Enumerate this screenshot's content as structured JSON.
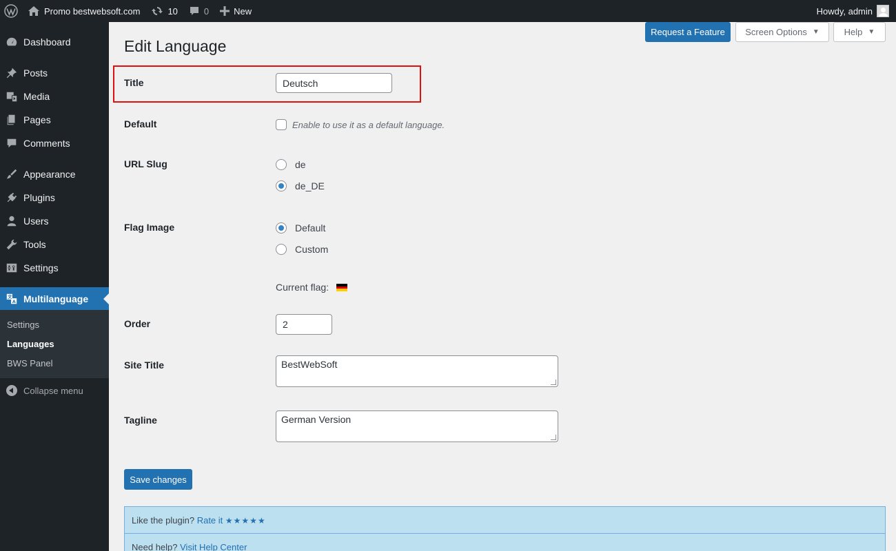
{
  "adminbar": {
    "site_name": "Promo bestwebsoft.com",
    "updates_count": "10",
    "comments_count": "0",
    "new_label": "New",
    "greeting": "Howdy, admin"
  },
  "sidebar": {
    "items": [
      {
        "label": "Dashboard",
        "icon": "dashboard-icon"
      },
      {
        "label": "Posts",
        "icon": "pin-icon"
      },
      {
        "label": "Media",
        "icon": "media-icon"
      },
      {
        "label": "Pages",
        "icon": "pages-icon"
      },
      {
        "label": "Comments",
        "icon": "comment-icon"
      },
      {
        "label": "Appearance",
        "icon": "brush-icon"
      },
      {
        "label": "Plugins",
        "icon": "plug-icon"
      },
      {
        "label": "Users",
        "icon": "user-icon"
      },
      {
        "label": "Tools",
        "icon": "wrench-icon"
      },
      {
        "label": "Settings",
        "icon": "settings-icon"
      },
      {
        "label": "Multilanguage",
        "icon": "translate-icon"
      }
    ],
    "submenu": [
      "Settings",
      "Languages",
      "BWS Panel"
    ],
    "collapse_label": "Collapse menu"
  },
  "toolbar": {
    "request_feature": "Request a Feature",
    "screen_options": "Screen Options",
    "help": "Help"
  },
  "page": {
    "title": "Edit Language"
  },
  "form": {
    "title_label": "Title",
    "title_value": "Deutsch",
    "default_label": "Default",
    "default_desc": "Enable to use it as a default language.",
    "slug_label": "URL Slug",
    "slug_options": [
      "de",
      "de_DE"
    ],
    "slug_selected": "de_DE",
    "flag_label": "Flag Image",
    "flag_options": [
      "Default",
      "Custom"
    ],
    "flag_selected": "Default",
    "current_flag_label": "Current flag:",
    "order_label": "Order",
    "order_value": "2",
    "site_title_label": "Site Title",
    "site_title_value": "BestWebSoft",
    "tagline_label": "Tagline",
    "tagline_value": "German Version",
    "save_label": "Save changes"
  },
  "info": {
    "like_text": "Like the plugin?",
    "rate_link": "Rate it",
    "stars": "★★★★★",
    "help_text": "Need help?",
    "help_link": "Visit Help Center"
  },
  "colors": {
    "accent": "#2271b1",
    "adminbar": "#1d2327",
    "highlight": "#e01010"
  }
}
